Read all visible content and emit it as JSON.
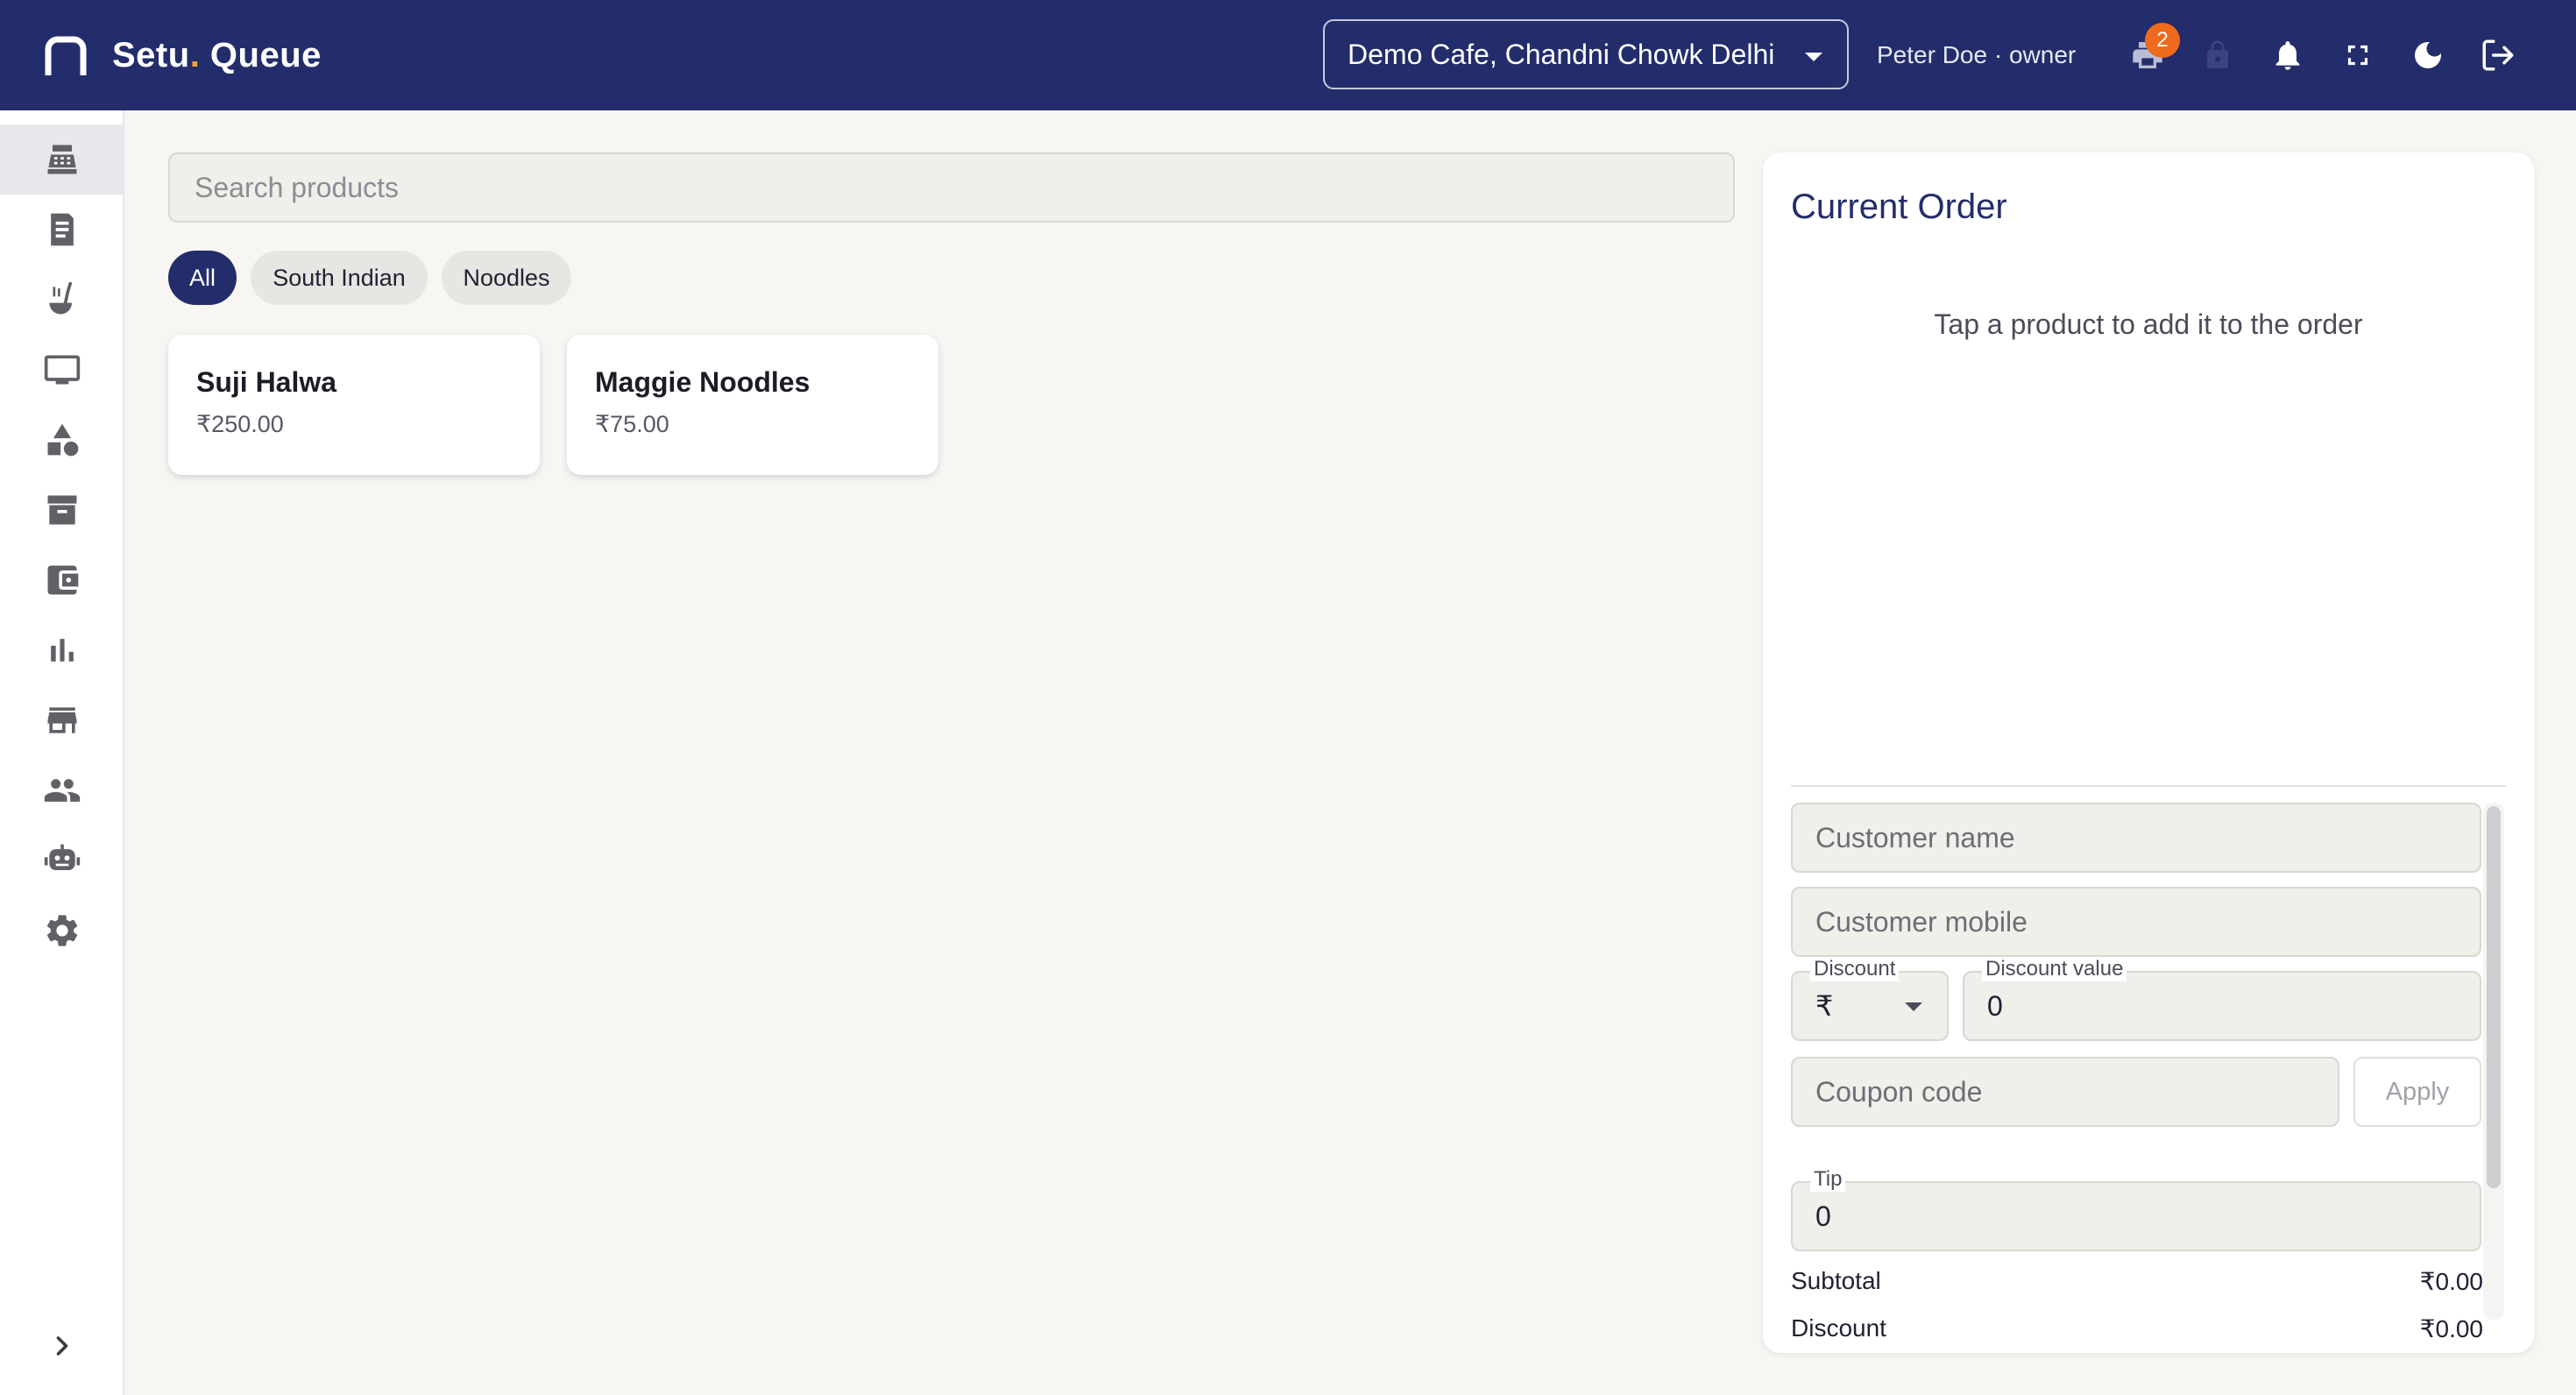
{
  "header": {
    "brand_name": "Setu",
    "brand_dot": ".",
    "brand_suffix": " Queue",
    "location": "Demo Cafe, Chandni Chowk Delhi",
    "user": "Peter Doe · owner",
    "printer_badge": "2",
    "icons": [
      "printer-icon",
      "lock-icon",
      "bell-icon",
      "fullscreen-icon",
      "dark-mode-icon",
      "logout-icon"
    ]
  },
  "sidebar": {
    "items": [
      {
        "icon": "cash-register-icon",
        "active": true
      },
      {
        "icon": "receipt-icon",
        "active": false
      },
      {
        "icon": "ladle-icon",
        "active": false
      },
      {
        "icon": "monitor-icon",
        "active": false
      },
      {
        "icon": "shapes-icon",
        "active": false
      },
      {
        "icon": "archive-icon",
        "active": false
      },
      {
        "icon": "wallet-icon",
        "active": false
      },
      {
        "icon": "bar-chart-icon",
        "active": false
      },
      {
        "icon": "store-icon",
        "active": false
      },
      {
        "icon": "users-icon",
        "active": false
      },
      {
        "icon": "robot-icon",
        "active": false
      },
      {
        "icon": "gear-icon",
        "active": false
      }
    ],
    "expand_icon": "chevron-right-icon"
  },
  "main": {
    "search_placeholder": "Search products",
    "categories": [
      {
        "label": "All",
        "active": true
      },
      {
        "label": "South Indian",
        "active": false
      },
      {
        "label": "Noodles",
        "active": false
      }
    ],
    "products": [
      {
        "name": "Suji Halwa",
        "price": "₹250.00"
      },
      {
        "name": "Maggie Noodles",
        "price": "₹75.00"
      }
    ]
  },
  "order": {
    "title": "Current Order",
    "empty_message": "Tap a product to add it to the order",
    "customer_name_placeholder": "Customer name",
    "customer_mobile_placeholder": "Customer mobile",
    "discount_label": "Discount",
    "discount_type": "₹",
    "discount_value_label": "Discount value",
    "discount_value": "0",
    "coupon_placeholder": "Coupon code",
    "apply_label": "Apply",
    "tip_label": "Tip",
    "tip_value": "0",
    "subtotal_label": "Subtotal",
    "subtotal_value": "₹0.00",
    "discount_row_label": "Discount",
    "discount_row_value": "₹0.00"
  },
  "colors": {
    "header_bg": "#232d6b",
    "accent_dot": "#f0a23a",
    "badge": "#ee6a1c",
    "page_bg": "#f7f6f3",
    "icon_gray": "#5f6166"
  }
}
